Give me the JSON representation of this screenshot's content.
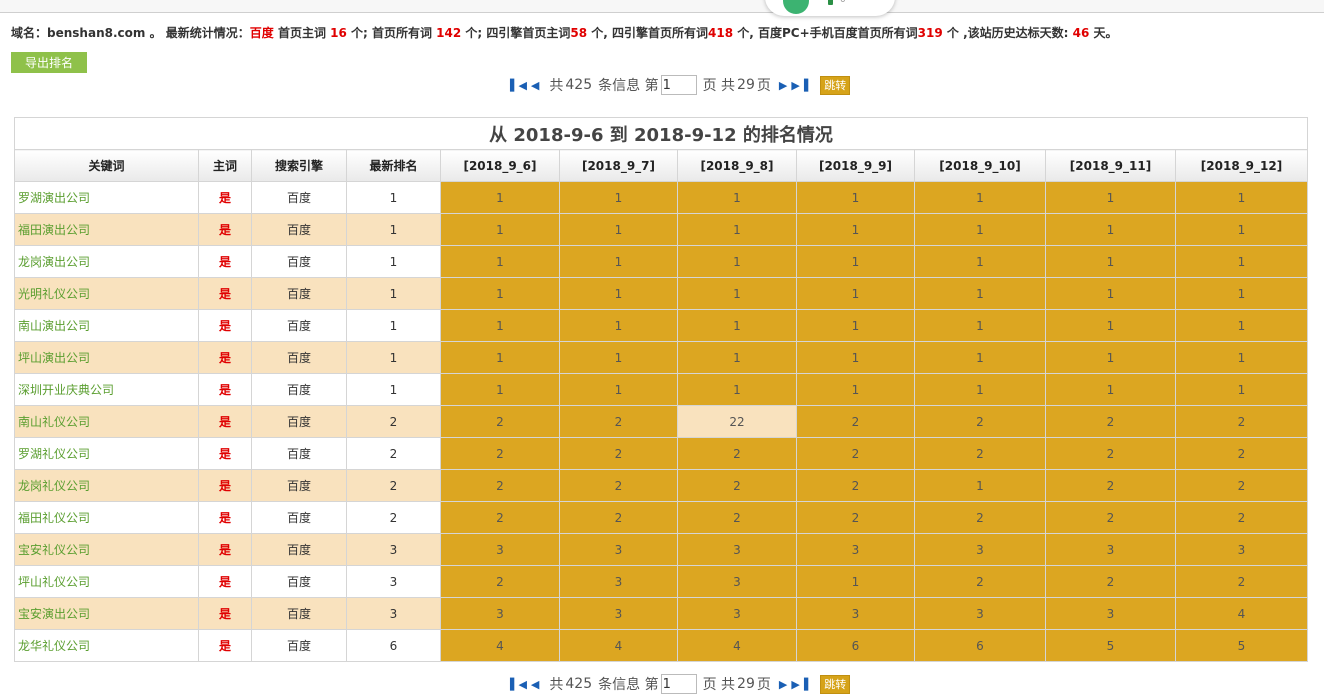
{
  "stats": {
    "domain_label": "域名：",
    "domain": "benshan8.com",
    "sep1": " 。   最新统计情况：",
    "engine": "百度",
    "t1": " 首页主词 ",
    "v1": "16",
    "t2": " 个; 首页所有词 ",
    "v2": "142",
    "t3": " 个; 四引擎首页主词",
    "v3": "58",
    "t4": " 个, 四引擎首页所有词",
    "v4": "418",
    "t5": " 个, 百度PC+手机百度首页所有词",
    "v5": "319",
    "t6": " 个 ,该站历史达标天数: ",
    "v6": "46",
    "t7": " 天。"
  },
  "export_label": "导出排名",
  "pager": {
    "total_prefix": "共",
    "total": "425",
    "total_suffix": "条信息 第",
    "page": "1",
    "pages_prefix": "页 共",
    "pages": "29",
    "pages_suffix": "页",
    "jump_label": "跳转"
  },
  "table": {
    "caption": "从 2018-9-6 到 2018-9-12 的排名情况",
    "headers": [
      "关键词",
      "主词",
      "搜索引擎",
      "最新排名",
      "[2018_9_6]",
      "[2018_9_7]",
      "[2018_9_8]",
      "[2018_9_9]",
      "[2018_9_10]",
      "[2018_9_11]",
      "[2018_9_12]"
    ],
    "rows": [
      {
        "keyword": "罗湖演出公司",
        "main": "是",
        "engine": "百度",
        "latest": "1",
        "days": [
          "1",
          "1",
          "1",
          "1",
          "1",
          "1",
          "1"
        ]
      },
      {
        "keyword": "福田演出公司",
        "main": "是",
        "engine": "百度",
        "latest": "1",
        "days": [
          "1",
          "1",
          "1",
          "1",
          "1",
          "1",
          "1"
        ]
      },
      {
        "keyword": "龙岗演出公司",
        "main": "是",
        "engine": "百度",
        "latest": "1",
        "days": [
          "1",
          "1",
          "1",
          "1",
          "1",
          "1",
          "1"
        ]
      },
      {
        "keyword": "光明礼仪公司",
        "main": "是",
        "engine": "百度",
        "latest": "1",
        "days": [
          "1",
          "1",
          "1",
          "1",
          "1",
          "1",
          "1"
        ]
      },
      {
        "keyword": "南山演出公司",
        "main": "是",
        "engine": "百度",
        "latest": "1",
        "days": [
          "1",
          "1",
          "1",
          "1",
          "1",
          "1",
          "1"
        ]
      },
      {
        "keyword": "坪山演出公司",
        "main": "是",
        "engine": "百度",
        "latest": "1",
        "days": [
          "1",
          "1",
          "1",
          "1",
          "1",
          "1",
          "1"
        ]
      },
      {
        "keyword": "深圳开业庆典公司",
        "main": "是",
        "engine": "百度",
        "latest": "1",
        "days": [
          "1",
          "1",
          "1",
          "1",
          "1",
          "1",
          "1"
        ]
      },
      {
        "keyword": "南山礼仪公司",
        "main": "是",
        "engine": "百度",
        "latest": "2",
        "days": [
          "2",
          "2",
          "22",
          "2",
          "2",
          "2",
          "2"
        ],
        "highlight": [
          2
        ]
      },
      {
        "keyword": "罗湖礼仪公司",
        "main": "是",
        "engine": "百度",
        "latest": "2",
        "days": [
          "2",
          "2",
          "2",
          "2",
          "2",
          "2",
          "2"
        ]
      },
      {
        "keyword": "龙岗礼仪公司",
        "main": "是",
        "engine": "百度",
        "latest": "2",
        "days": [
          "2",
          "2",
          "2",
          "2",
          "1",
          "2",
          "2"
        ]
      },
      {
        "keyword": "福田礼仪公司",
        "main": "是",
        "engine": "百度",
        "latest": "2",
        "days": [
          "2",
          "2",
          "2",
          "2",
          "2",
          "2",
          "2"
        ]
      },
      {
        "keyword": "宝安礼仪公司",
        "main": "是",
        "engine": "百度",
        "latest": "3",
        "days": [
          "3",
          "3",
          "3",
          "3",
          "3",
          "3",
          "3"
        ]
      },
      {
        "keyword": "坪山礼仪公司",
        "main": "是",
        "engine": "百度",
        "latest": "3",
        "days": [
          "2",
          "3",
          "3",
          "1",
          "2",
          "2",
          "2"
        ]
      },
      {
        "keyword": "宝安演出公司",
        "main": "是",
        "engine": "百度",
        "latest": "3",
        "days": [
          "3",
          "3",
          "3",
          "3",
          "3",
          "3",
          "4"
        ]
      },
      {
        "keyword": "龙华礼仪公司",
        "main": "是",
        "engine": "百度",
        "latest": "6",
        "days": [
          "4",
          "4",
          "4",
          "6",
          "6",
          "5",
          "5"
        ]
      }
    ]
  },
  "colors": {
    "rank_cell": "#dca621",
    "stripe": "#f9e2be",
    "keyword": "#5a9e2f",
    "red": "#e00000",
    "export": "#8fc14a",
    "jump": "#d6a319"
  },
  "icons": {
    "first": "first-page-icon",
    "prev": "prev-page-icon",
    "next": "next-page-icon",
    "last": "last-page-icon"
  }
}
